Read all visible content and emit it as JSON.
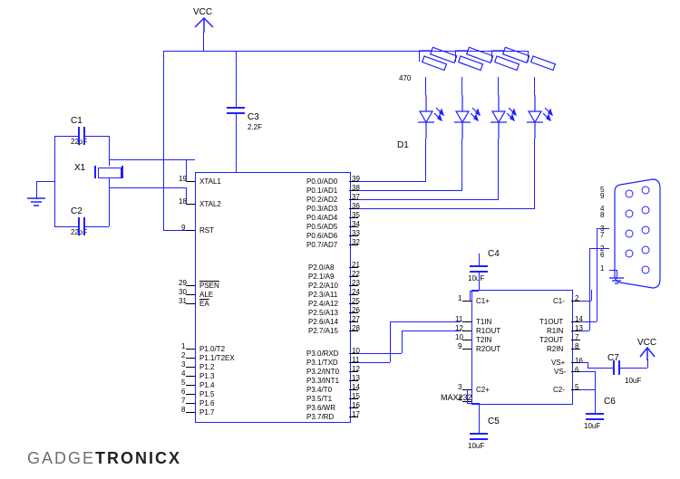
{
  "vcc1": "VCC",
  "vcc2": "VCC",
  "c1": {
    "ref": "C1",
    "val": "22pF"
  },
  "c2": {
    "ref": "C2",
    "val": "22pF"
  },
  "c3": {
    "ref": "C3",
    "val": "2.2F"
  },
  "c4": {
    "ref": "C4",
    "val": "10uF"
  },
  "c5": {
    "ref": "C5",
    "val": "10uF"
  },
  "c6": {
    "ref": "C6",
    "val": "10uF"
  },
  "c7": {
    "ref": "C7",
    "val": "10uF"
  },
  "x1": "X1",
  "d1": "D1",
  "r470": "470",
  "mcu": {
    "left": {
      "19": "XTAL1",
      "18": "XTAL2",
      "9": "RST",
      "29": "PSEN",
      "30": "ALE",
      "31": "EA",
      "1": "P1.0/T2",
      "2": "P1.1/T2EX",
      "3": "P1.2",
      "4": "P1.3",
      "5": "P1.4",
      "6": "P1.5",
      "7": "P1.6",
      "8": "P1.7"
    },
    "right": {
      "39": "P0.0/AD0",
      "38": "P0.1/AD1",
      "37": "P0.2/AD2",
      "36": "P0.3/AD3",
      "35": "P0.4/AD4",
      "34": "P0.5/AD5",
      "33": "P0.6/AD6",
      "32": "P0.7/AD7",
      "21": "P2.0/A8",
      "22": "P2.1/A9",
      "23": "P2.2/A10",
      "24": "P2.3/A11",
      "25": "P2.4/A12",
      "26": "P2.5/A13",
      "27": "P2.6/A14",
      "28": "P2.7/A15",
      "10": "P3.0/RXD",
      "11": "P3.1/TXD",
      "12": "P3.2/INT0",
      "13": "P3.3/INT1",
      "14": "P3.4/T0",
      "15": "P3.5/T1",
      "16": "P3.6/WR",
      "17": "P3.7/RD"
    }
  },
  "max232": {
    "name": "MAX232",
    "left": {
      "1": "C1+",
      "11": "T1IN",
      "12": "R1OUT",
      "10": "T2IN",
      "9": "R2OUT",
      "3": "C2+",
      "4": ""
    },
    "right": {
      "2": "C1-",
      "14": "T1OUT",
      "13": "R1IN",
      "7": "T2OUT",
      "8": "R2IN",
      "16": "VS+",
      "6": "VS-",
      "5": "C2-"
    }
  },
  "db9": {
    "1": "1",
    "2": "2",
    "3": "3",
    "4": "4",
    "5": "5",
    "6": "6",
    "7": "7",
    "8": "8",
    "9": "9"
  },
  "brand": {
    "a": "GADGE",
    "b": "TRONICX"
  }
}
